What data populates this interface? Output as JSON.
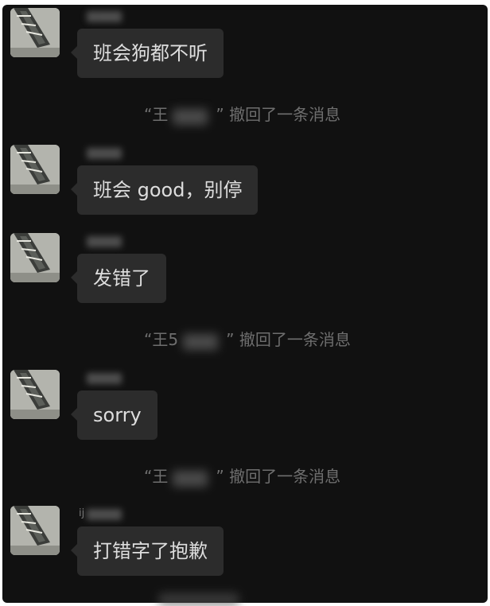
{
  "chat": {
    "messages": [
      {
        "sender_initial": "",
        "text": "班会狗都不听"
      },
      {
        "sender_initial": "",
        "text": "班会 good，别停"
      },
      {
        "sender_initial": "",
        "text": "发错了"
      },
      {
        "sender_initial": "",
        "text": "sorry"
      },
      {
        "sender_initial": "ij",
        "text": "打错字了抱歉"
      }
    ],
    "recalls": [
      {
        "name_start": "“王",
        "name_end": "”",
        "suffix": " 撤回了一条消息"
      },
      {
        "name_start": "“王5",
        "name_end": "”",
        "suffix": " 撤回了一条消息"
      },
      {
        "name_start": "“王",
        "name_end": "”",
        "suffix": " 撤回了一条消息"
      }
    ]
  },
  "colors": {
    "background": "#111111",
    "bubble": "#2c2c2c",
    "text": "#dedede",
    "system_text": "#6e6e6e"
  }
}
